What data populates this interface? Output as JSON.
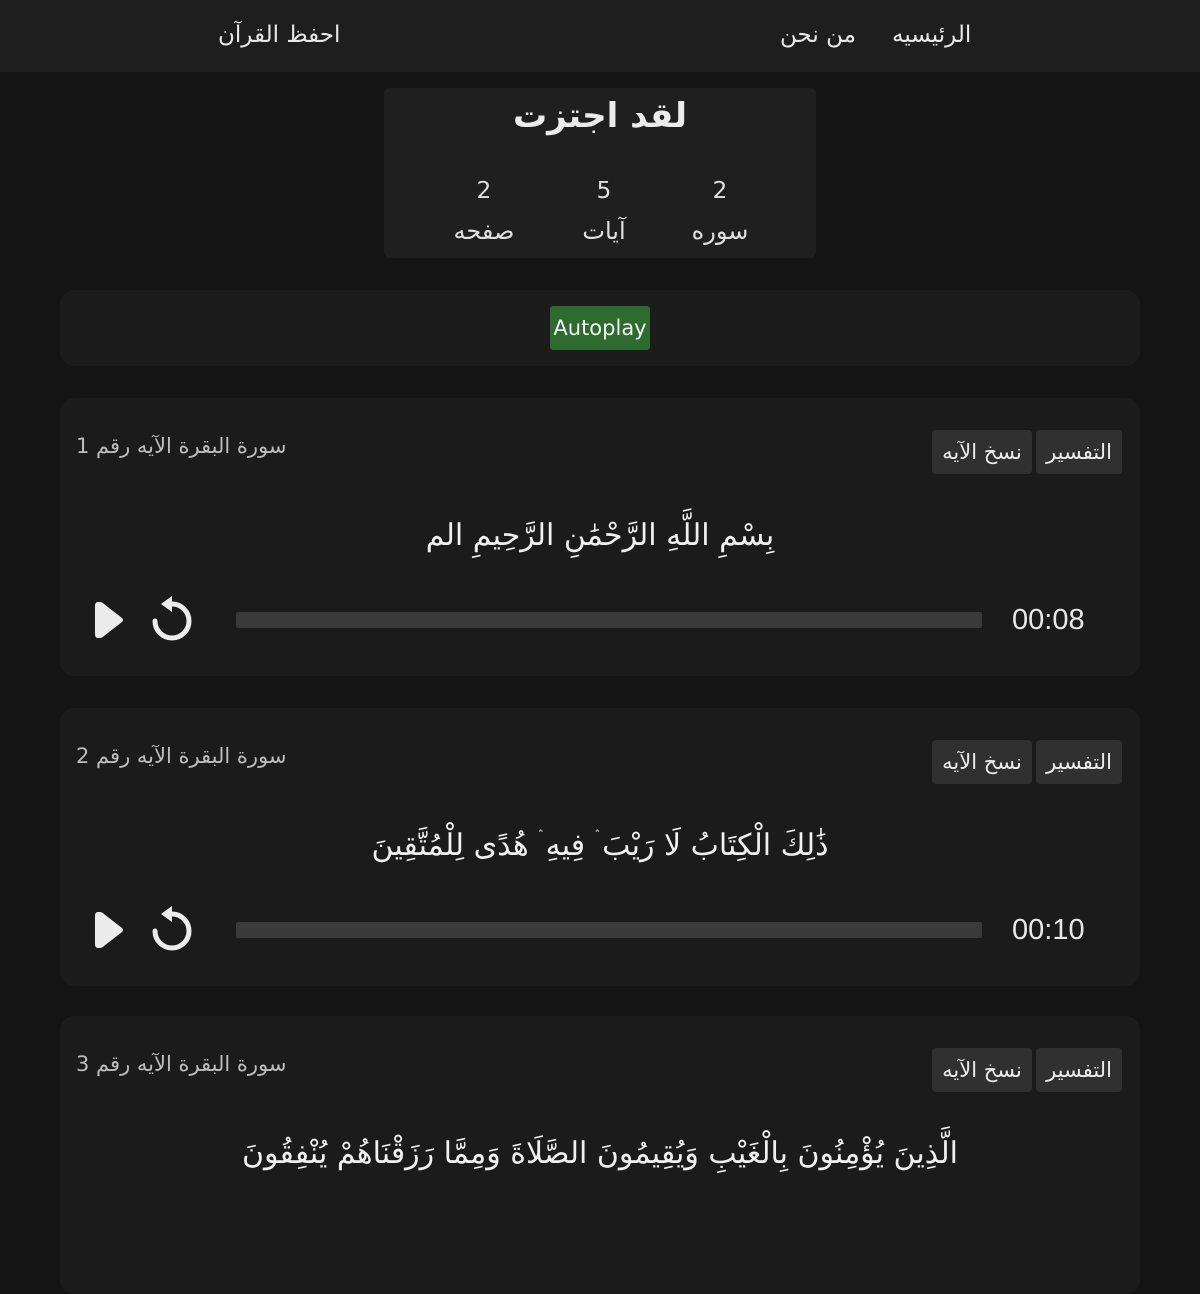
{
  "nav": {
    "home": "الرئيسيه",
    "about": "من نحن",
    "brand": "احفظ القرآن"
  },
  "stats": {
    "title": "لقد اجتزت",
    "surah": {
      "value": "2",
      "label": "سوره"
    },
    "ayat": {
      "value": "5",
      "label": "آيات"
    },
    "page": {
      "value": "2",
      "label": "صفحه"
    }
  },
  "autoplay": {
    "label": "Autoplay",
    "color": "#2e6b30"
  },
  "ayahs": [
    {
      "ref": "سورة البقرة الآيه رقم 1",
      "tafsir_label": "التفسير",
      "copy_label": "نسخ الآيه",
      "text": "بِسْمِ اللَّهِ الرَّحْمَٰنِ الرَّحِيمِ الم",
      "time": "00:08",
      "progress": 0
    },
    {
      "ref": "سورة البقرة الآيه رقم 2",
      "tafsir_label": "التفسير",
      "copy_label": "نسخ الآيه",
      "text": "ذَٰلِكَ الْكِتَابُ لَا رَيْبَ ۛ فِيهِ ۛ هُدًى لِلْمُتَّقِينَ",
      "time": "00:10",
      "progress": 0
    },
    {
      "ref": "سورة البقرة الآيه رقم 3",
      "tafsir_label": "التفسير",
      "copy_label": "نسخ الآيه",
      "text": "الَّذِينَ يُؤْمِنُونَ بِالْغَيْبِ وَيُقِيمُونَ الصَّلَاةَ وَمِمَّا رَزَقْنَاهُمْ يُنْفِقُونَ"
    }
  ]
}
